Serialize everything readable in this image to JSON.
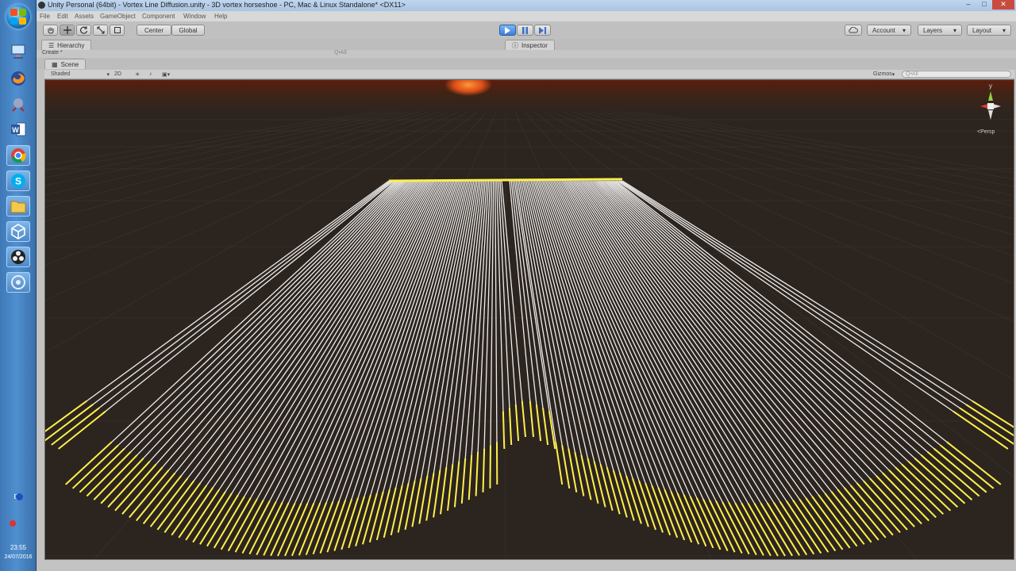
{
  "window": {
    "title": "Unity Personal (64bit) - Vortex Line Diffusion.unity - 3D vortex horseshoe - PC, Mac & Linux Standalone* <DX11>",
    "controls": [
      "–",
      "□",
      "✕"
    ]
  },
  "menu": [
    "File",
    "Edit",
    "Assets",
    "GameObject",
    "Component",
    "Window",
    "Help"
  ],
  "toolbar": {
    "tools": [
      "hand-icon",
      "move-icon",
      "rotate-icon",
      "scale-icon",
      "rect-icon"
    ],
    "pivot_label": "Center",
    "space_label": "Global",
    "play_buttons": [
      "play-icon",
      "pause-icon",
      "step-icon"
    ],
    "cloud_icon": "cloud-icon",
    "account_label": "Account",
    "layers_label": "Layers",
    "layout_label": "Layout"
  },
  "panels": {
    "hierarchy_label": "Hierarchy",
    "hierarchy_create": "Create *",
    "hierarchy_search": "Q•All",
    "inspector_label": "Inspector"
  },
  "scene": {
    "tab_label": "Scene",
    "shading_mode": "Shaded",
    "mode_2d": "2D",
    "gizmos_label": "Gizmos",
    "search_placeholder": "Q•All",
    "projection_label": "<Persp",
    "gizmo_axis_label": "y"
  },
  "system": {
    "language": "EN",
    "time": "23:55",
    "date": "24/07/2016"
  },
  "taskbar_icons": [
    "start-orb",
    "network-icon",
    "firefox-icon",
    "remote-icon",
    "word-icon",
    "chrome-icon",
    "skype-icon",
    "folder-icon",
    "unity-icon",
    "obs-icon",
    "app-icon"
  ],
  "colors": {
    "viewport_bg": "#2c241e",
    "grid": "#4a4038",
    "lines": "#ffffff",
    "highlight": "#ffef4a",
    "sun": "#ff6a2a"
  }
}
